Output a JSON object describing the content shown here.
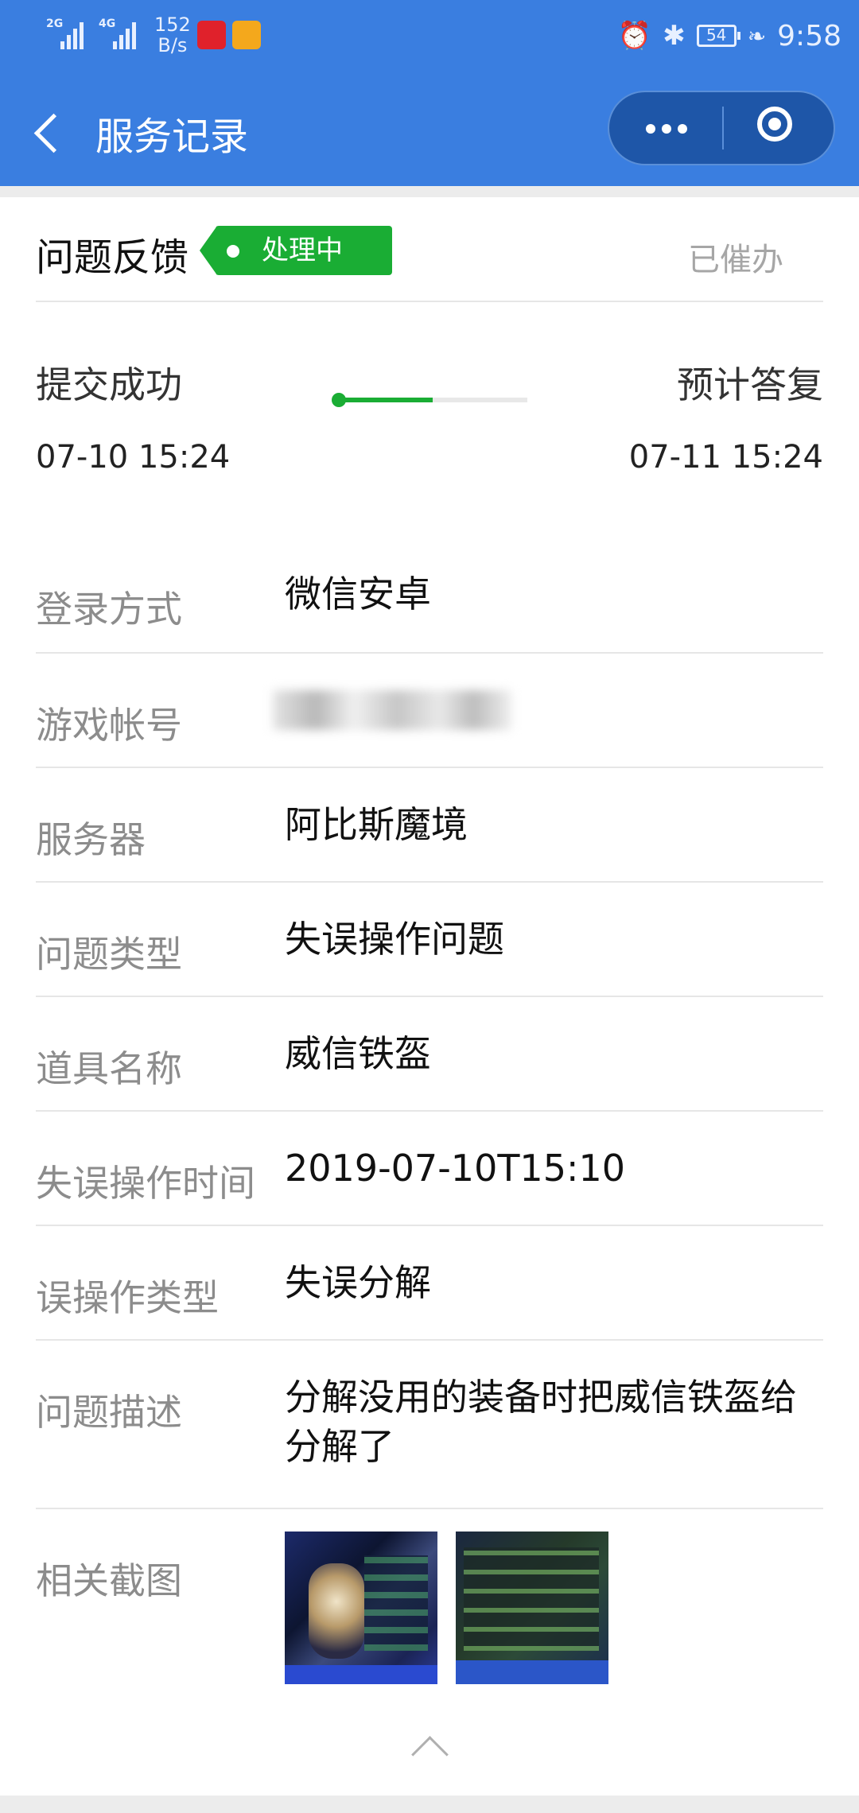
{
  "status_bar": {
    "signal1": "2G",
    "signal2": "4G",
    "net_speed_value": "152",
    "net_speed_unit": "B/s",
    "battery": "54",
    "time": "9:58"
  },
  "nav": {
    "title": "服务记录"
  },
  "ticket": {
    "title": "问题反馈",
    "status": "处理中",
    "urge_label": "已催办"
  },
  "progress": {
    "start_label": "提交成功",
    "end_label": "预计答复",
    "start_time": "07-10 15:24",
    "end_time": "07-11 15:24",
    "fraction": 0.5
  },
  "details": [
    {
      "label": "登录方式",
      "value": "微信安卓"
    },
    {
      "label": "游戏帐号",
      "value": ""
    },
    {
      "label": "服务器",
      "value": "阿比斯魔境"
    },
    {
      "label": "问题类型",
      "value": "失误操作问题"
    },
    {
      "label": "道具名称",
      "value": "威信铁盔"
    },
    {
      "label": "失误操作时间",
      "value": "2019-07-10T15:10"
    },
    {
      "label": "误操作类型",
      "value": "失误分解"
    },
    {
      "label": "问题描述",
      "value": "分解没用的装备时把威信铁盔给分解了"
    },
    {
      "label": "相关截图",
      "value": ""
    }
  ],
  "colors": {
    "header": "#3a7ee0",
    "status_green": "#1aad34"
  }
}
